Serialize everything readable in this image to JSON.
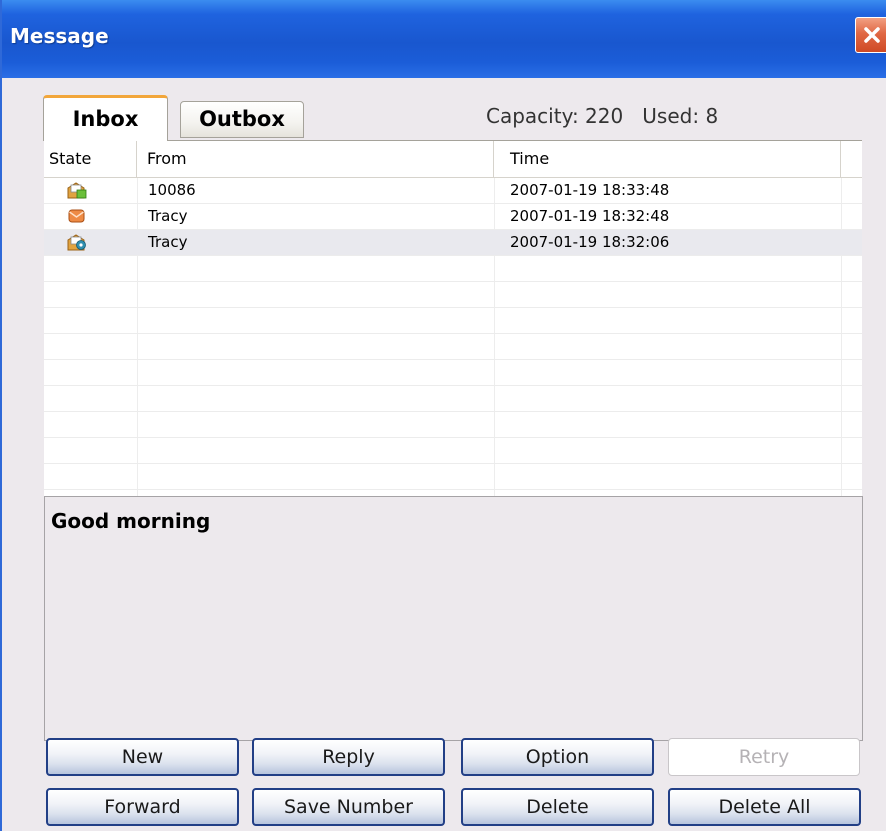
{
  "window": {
    "title": "Message",
    "close_icon": "close-icon",
    "colors": {
      "titlebar": "#1957cf",
      "close_button": "#d85a35",
      "client_background": "#ede9ed",
      "active_tab_accent": "#f2a63a",
      "button_border": "#223f86"
    }
  },
  "tabs": [
    {
      "label": "Inbox",
      "active": true
    },
    {
      "label": "Outbox",
      "active": false
    }
  ],
  "capacity": {
    "capacity_text": "Capacity: 220",
    "used_text": "Used: 8"
  },
  "table": {
    "columns": [
      "State",
      "From",
      "Time"
    ],
    "rows": [
      {
        "state_icon": "read-message-icon",
        "from": "10086",
        "time": "2007-01-19 18:33:48",
        "selected": false
      },
      {
        "state_icon": "unread-message-icon",
        "from": "Tracy",
        "time": "2007-01-19 18:32:48",
        "selected": false
      },
      {
        "state_icon": "read-locked-message-icon",
        "from": "Tracy",
        "time": "2007-01-19 18:32:06",
        "selected": true
      }
    ]
  },
  "preview": {
    "text": "Good morning"
  },
  "buttons": {
    "new": "New",
    "reply": "Reply",
    "option": "Option",
    "retry": "Retry",
    "forward": "Forward",
    "save_number": "Save Number",
    "delete": "Delete",
    "delete_all": "Delete All"
  }
}
